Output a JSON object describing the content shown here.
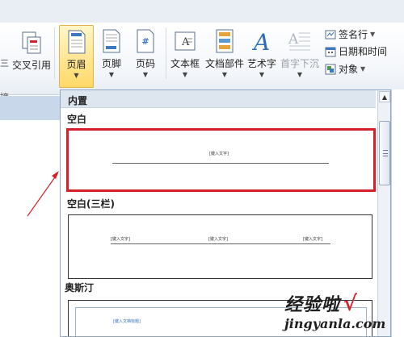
{
  "ribbon": {
    "left_group": {
      "partial_label": "交叉引用",
      "cut_label_1": "三",
      "cut_label_2": "接"
    },
    "buttons": {
      "header": "页眉",
      "footer": "页脚",
      "page_number": "页码",
      "textbox": "文本框",
      "quick_parts": "文档部件",
      "wordart": "艺术字",
      "dropcap": "首字下沉"
    },
    "small_buttons": {
      "signature_line": "签名行",
      "date_time": "日期和时间",
      "object": "对象"
    }
  },
  "gallery": {
    "header": "内置",
    "sections": [
      {
        "title": "空白",
        "placeholder": "[键入文字]"
      },
      {
        "title": "空白(三栏)",
        "placeholders": [
          "[键入文字]",
          "[键入文字]",
          "[键入文字]"
        ]
      },
      {
        "title": "奥斯汀",
        "placeholder": "[键入文档标题]"
      }
    ]
  },
  "colors": {
    "selection": "#d4202a",
    "active_button": "#ffd967",
    "ribbon_border": "#c5d1e0"
  },
  "watermark": {
    "text": "经验啦",
    "url": "jingyanla.com"
  }
}
